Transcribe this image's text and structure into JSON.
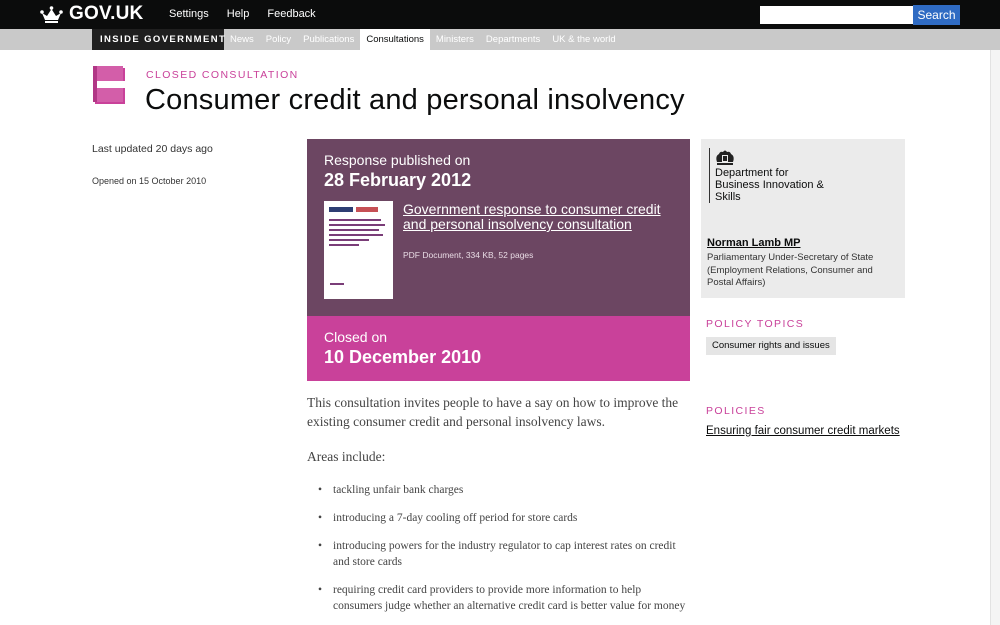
{
  "header": {
    "logo_text": "GOV.UK",
    "nav": [
      "Settings",
      "Help",
      "Feedback"
    ],
    "search_placeholder": "",
    "search_button": "Search"
  },
  "subnav": {
    "section_label": "INSIDE GOVERNMENT",
    "tabs": [
      "News",
      "Policy",
      "Publications",
      "Consultations",
      "Ministers",
      "Departments",
      "UK & the world"
    ],
    "active_tab": "Consultations"
  },
  "page": {
    "eyebrow": "CLOSED CONSULTATION",
    "title": "Consumer credit and personal insolvency",
    "last_updated": "Last updated 20 days ago",
    "opened_on": "Opened on 15 October 2010"
  },
  "response": {
    "label": "Response published on",
    "date": "28 February 2012",
    "document_title": "Government response to consumer credit and personal insolvency consultation",
    "document_meta": "PDF Document, 334 KB, 52 pages"
  },
  "closed": {
    "label": "Closed on",
    "date": "10 December 2010"
  },
  "body": {
    "intro": "This consultation invites people to have a say on how to improve the existing consumer credit and personal insolvency laws.",
    "areas_heading": "Areas include:",
    "areas": [
      "tackling unfair bank charges",
      "introducing a 7-day cooling off period for store cards",
      "introducing powers for the industry regulator to cap interest rates on credit and store cards",
      "requiring credit card providers to provide more information to help consumers judge whether an alternative credit card is better value for money"
    ]
  },
  "sidebar": {
    "organisation": "Department for Business Innovation & Skills",
    "minister_name": "Norman Lamb MP",
    "minister_role": "Parliamentary Under-Secretary of State (Employment Relations, Consumer and Postal Affairs)",
    "topics_heading": "POLICY TOPICS",
    "topics": [
      "Consumer rights and issues"
    ],
    "policies_heading": "POLICIES",
    "policies": [
      "Ensuring fair consumer credit markets"
    ]
  },
  "colors": {
    "accent_pink": "#c9419a",
    "response_purple": "#6c4662",
    "search_blue": "#2f6bc3"
  }
}
